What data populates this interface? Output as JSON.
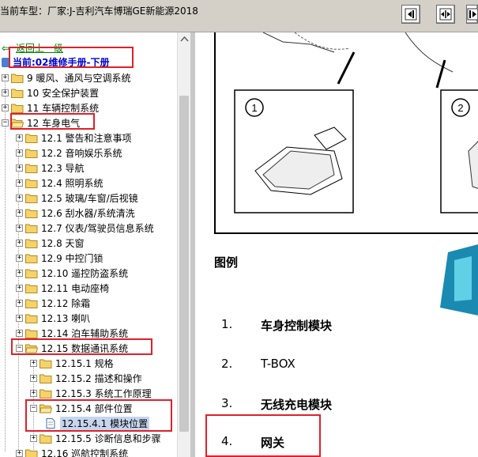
{
  "header": {
    "vehicle_label": "当前车型：厂家:J-吉利汽车博瑞GE新能源2018",
    "buttons": [
      {
        "name": "collapse-left-button",
        "icon": "panel-left-icon"
      },
      {
        "name": "split-view-button",
        "icon": "panel-split-icon"
      },
      {
        "name": "expand-right-button",
        "icon": "panel-right-icon"
      }
    ]
  },
  "tree": {
    "back_link": "返回上一级",
    "current_label": "当前:02维修手册-下册",
    "items": [
      {
        "label": "9 暖风、通风与空调系统",
        "level": 0
      },
      {
        "label": "10 安全保护装置",
        "level": 0
      },
      {
        "label": "11 车辆控制系统",
        "level": 0
      },
      {
        "label": "12 车身电气",
        "level": 0,
        "expanded": true
      },
      {
        "label": "12.1 警告和注意事项",
        "level": 1
      },
      {
        "label": "12.2 音响娱乐系统",
        "level": 1
      },
      {
        "label": "12.3 导航",
        "level": 1
      },
      {
        "label": "12.4 照明系统",
        "level": 1
      },
      {
        "label": "12.5 玻璃/车窗/后视镜",
        "level": 1
      },
      {
        "label": "12.6 刮水器/系统清洗",
        "level": 1
      },
      {
        "label": "12.7 仪表/驾驶员信息系统",
        "level": 1
      },
      {
        "label": "12.8 天窗",
        "level": 1
      },
      {
        "label": "12.9 中控门锁",
        "level": 1
      },
      {
        "label": "12.10 遥控防盗系统",
        "level": 1
      },
      {
        "label": "12.11 电动座椅",
        "level": 1
      },
      {
        "label": "12.12 除霜",
        "level": 1
      },
      {
        "label": "12.13 喇叭",
        "level": 1
      },
      {
        "label": "12.14 泊车辅助系统",
        "level": 1
      },
      {
        "label": "12.15 数据通讯系统",
        "level": 1,
        "expanded": true
      },
      {
        "label": "12.15.1 规格",
        "level": 2
      },
      {
        "label": "12.15.2 描述和操作",
        "level": 2
      },
      {
        "label": "12.15.3 系统工作原理",
        "level": 2
      },
      {
        "label": "12.15.4 部件位置",
        "level": 2,
        "expanded": true
      },
      {
        "label": "12.15.4.1 模块位置",
        "level": 3,
        "selected": true,
        "doc": true
      },
      {
        "label": "12.15.5 诊断信息和步骤",
        "level": 2
      },
      {
        "label": "12.16 巡航控制系统",
        "level": 1
      }
    ]
  },
  "document": {
    "diagram_callouts": [
      "1",
      "2"
    ],
    "legend_title": "图例",
    "legend": [
      {
        "num": "1.",
        "text": "车身控制模块"
      },
      {
        "num": "2.",
        "text": "T-BOX"
      },
      {
        "num": "3.",
        "text": "无线充电模块"
      },
      {
        "num": "4.",
        "text": "网关"
      }
    ]
  },
  "colors": {
    "highlight_box": "#e0202a",
    "link_green": "#008000",
    "link_blue": "#0000cc",
    "selection": "#c5d6ee",
    "folder": "#f5d36a"
  }
}
